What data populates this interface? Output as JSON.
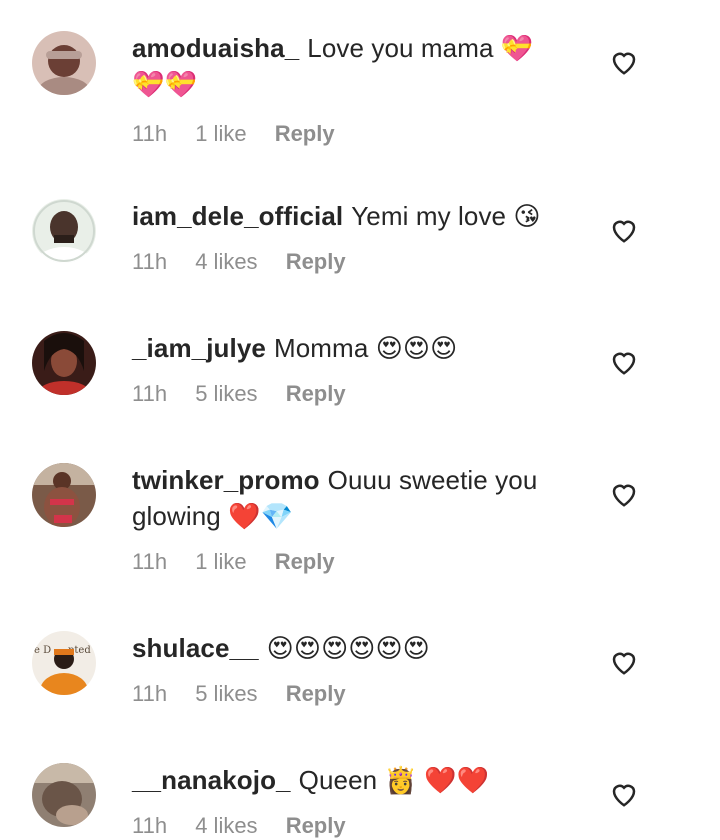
{
  "comments": [
    {
      "username": "amoduaisha_",
      "text": "Love you mama 💝 💝💝",
      "time": "11h",
      "likes": "1 like",
      "reply": "Reply",
      "avatar_color": "#c9a79c"
    },
    {
      "username": "iam_dele_official",
      "text": "Yemi my love 😘",
      "time": "11h",
      "likes": "4 likes",
      "reply": "Reply",
      "avatar_color": "#3d2f2a"
    },
    {
      "username": "_iam_julye",
      "text": "Momma 😍😍😍",
      "time": "11h",
      "likes": "5 likes",
      "reply": "Reply",
      "avatar_color": "#5a2a22"
    },
    {
      "username": "twinker_promo",
      "text": "Ouuu sweetie you glowing ❤️💎",
      "time": "11h",
      "likes": "1 like",
      "reply": "Reply",
      "avatar_color": "#b45a4e"
    },
    {
      "username": "shulace__",
      "text": "😍😍😍😍😍😍",
      "time": "11h",
      "likes": "5 likes",
      "reply": "Reply",
      "avatar_color": "#e58a2c"
    },
    {
      "username": "__nanakojo_",
      "text": "Queen 👸 ❤️❤️",
      "time": "11h",
      "likes": "4 likes",
      "reply": "Reply",
      "avatar_color": "#7d6a5a"
    }
  ],
  "icons": {
    "like": "heart-outline-icon"
  }
}
